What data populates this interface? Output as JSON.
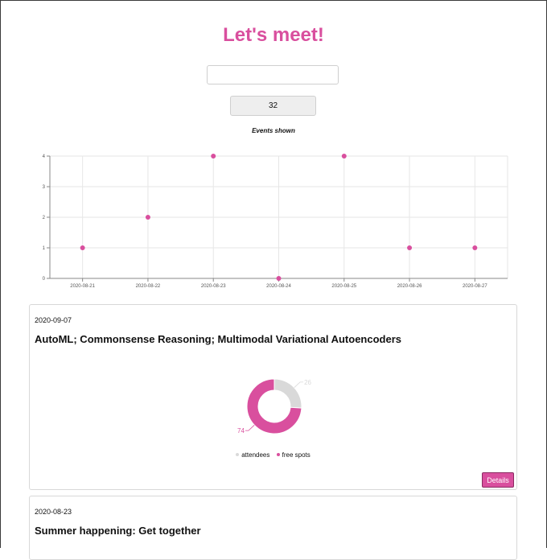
{
  "app": {
    "title": "Let's meet!"
  },
  "search": {
    "value": "",
    "placeholder": ""
  },
  "event_count": "32",
  "chart_data": {
    "type": "scatter",
    "title": "Events shown",
    "x": [
      "2020-08-21",
      "2020-08-22",
      "2020-08-23",
      "2020-08-24",
      "2020-08-25",
      "2020-08-26",
      "2020-08-27"
    ],
    "y": [
      1,
      2,
      4,
      0,
      4,
      1,
      1
    ],
    "yticks": [
      "0",
      "1",
      "2",
      "3",
      "4"
    ],
    "ylim": [
      0,
      4
    ],
    "grid": true,
    "color": "#d94f9e"
  },
  "cards": [
    {
      "date": "2020-09-07",
      "title": "AutoML; Commonsense Reasoning; Multimodal Variational Autoencoders",
      "donut": {
        "type": "pie",
        "slices": [
          {
            "label": "attendees",
            "value": 26,
            "color": "#d9d9d9"
          },
          {
            "label": "free spots",
            "value": 74,
            "color": "#d94f9e"
          }
        ]
      },
      "details_label": "Details"
    },
    {
      "date": "2020-08-23",
      "title": "Summer happening: Get together"
    }
  ],
  "colors": {
    "accent": "#d94f9e",
    "grid": "#e6e6e6",
    "muted": "#d9d9d9"
  }
}
